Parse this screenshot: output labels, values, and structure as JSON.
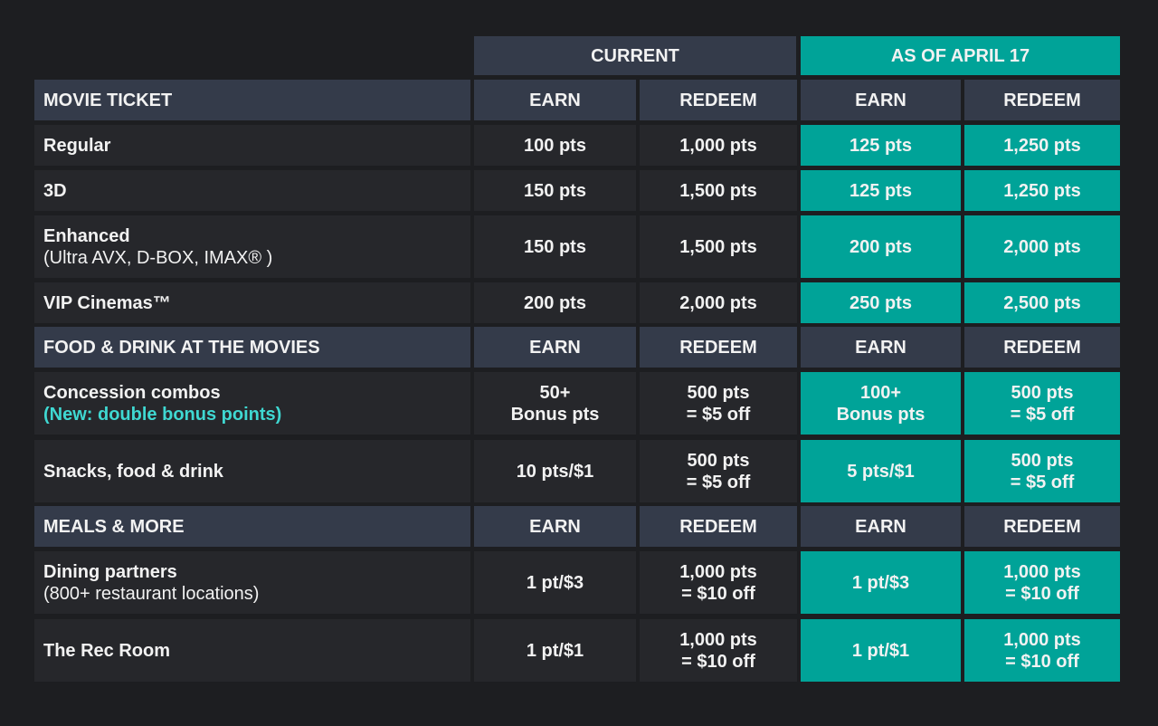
{
  "header": {
    "current": "CURRENT",
    "as_of": "AS OF APRIL 17"
  },
  "sections": [
    {
      "title": "MOVIE TICKET",
      "cols": [
        "EARN",
        "REDEEM",
        "EARN",
        "REDEEM"
      ],
      "rows": [
        {
          "label": "Regular",
          "cur_earn": "100 pts",
          "cur_redeem": "1,000 pts",
          "new_earn": "125 pts",
          "new_redeem": "1,250 pts"
        },
        {
          "label": "3D",
          "cur_earn": "150 pts",
          "cur_redeem": "1,500 pts",
          "new_earn": "125 pts",
          "new_redeem": "1,250 pts"
        },
        {
          "label": "Enhanced",
          "sublabel": "(Ultra AVX, D-BOX, IMAX® )",
          "cur_earn": "150 pts",
          "cur_redeem": "1,500 pts",
          "new_earn": "200 pts",
          "new_redeem": "2,000 pts"
        },
        {
          "label": "VIP Cinemas™",
          "cur_earn": "200 pts",
          "cur_redeem": "2,000 pts",
          "new_earn": "250 pts",
          "new_redeem": "2,500 pts"
        }
      ]
    },
    {
      "title": "FOOD & DRINK AT THE MOVIES",
      "cols": [
        "EARN",
        "REDEEM",
        "EARN",
        "REDEEM"
      ],
      "rows": [
        {
          "label": "Concession combos",
          "note": "(New: double bonus points)",
          "cur_earn": [
            "50+",
            "Bonus pts"
          ],
          "cur_redeem": [
            "500 pts",
            "= $5 off"
          ],
          "new_earn": [
            "100+",
            "Bonus pts"
          ],
          "new_redeem": [
            "500 pts",
            "= $5 off"
          ]
        },
        {
          "label": "Snacks, food & drink",
          "cur_earn": "10 pts/$1",
          "cur_redeem": [
            "500 pts",
            "= $5 off"
          ],
          "new_earn": "5 pts/$1",
          "new_redeem": [
            "500 pts",
            "= $5 off"
          ]
        }
      ]
    },
    {
      "title": "MEALS & MORE",
      "cols": [
        "EARN",
        "REDEEM",
        "EARN",
        "REDEEM"
      ],
      "rows": [
        {
          "label": "Dining partners",
          "sublabel": "(800+ restaurant locations)",
          "cur_earn": "1 pt/$3",
          "cur_redeem": [
            "1,000 pts",
            "= $10 off"
          ],
          "new_earn": "1 pt/$3",
          "new_redeem": [
            "1,000 pts",
            "= $10 off"
          ]
        },
        {
          "label": "The Rec Room",
          "cur_earn": "1 pt/$1",
          "cur_redeem": [
            "1,000 pts",
            "= $10 off"
          ],
          "new_earn": "1 pt/$1",
          "new_redeem": [
            "1,000 pts",
            "= $10 off"
          ]
        }
      ]
    }
  ]
}
